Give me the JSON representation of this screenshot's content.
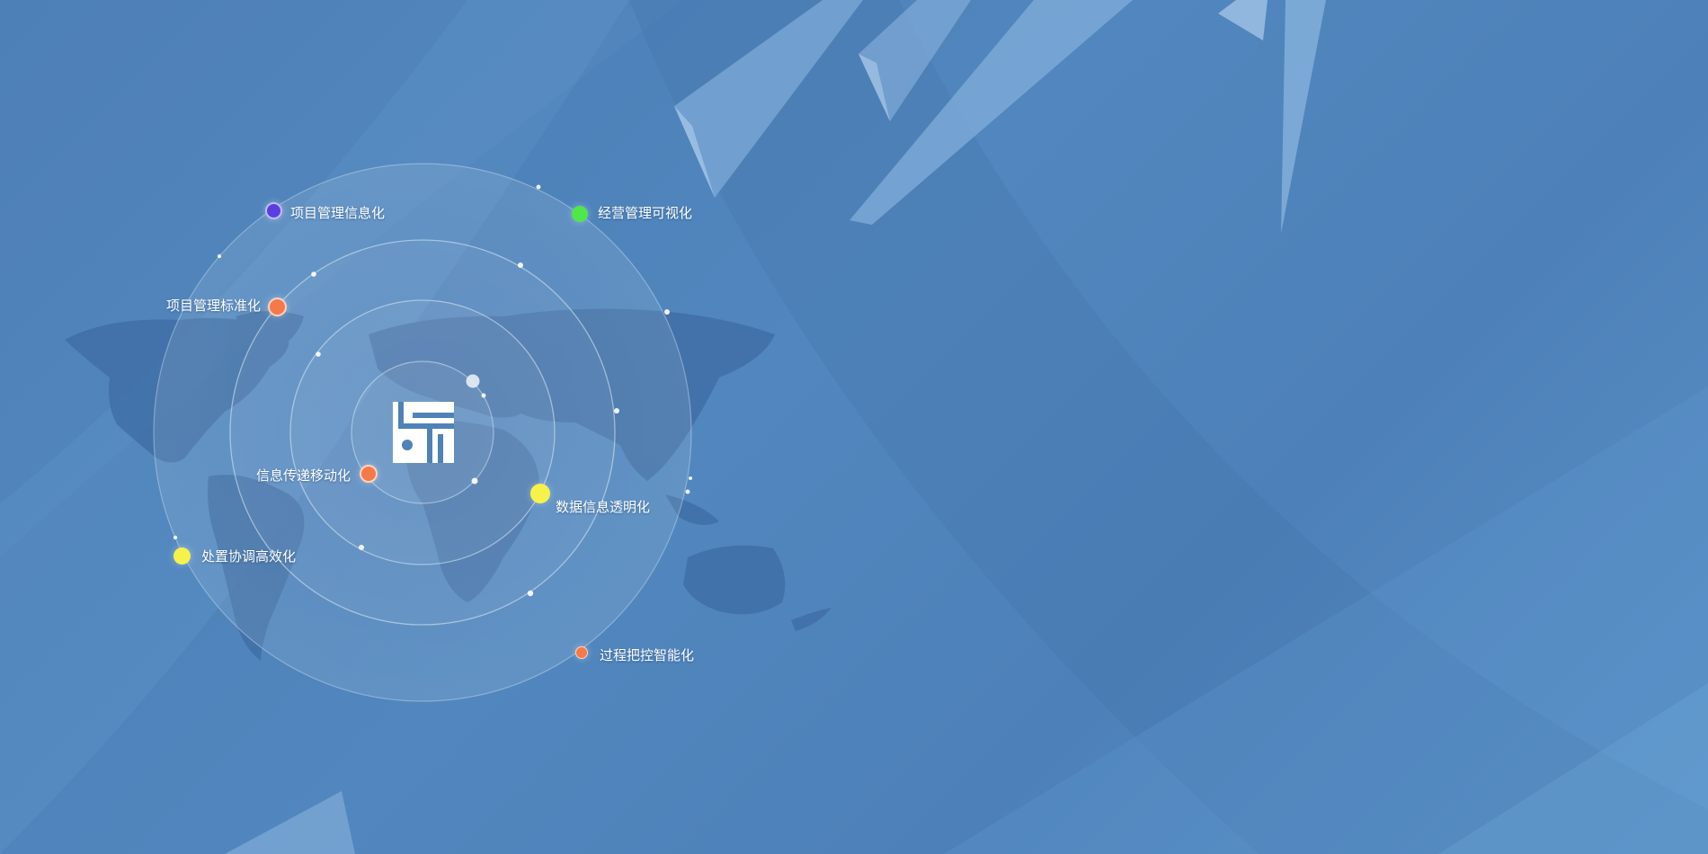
{
  "diagram": {
    "center_logo": "company-logo",
    "nodes": [
      {
        "label": "项目管理信息化",
        "color": "#5a3fe0"
      },
      {
        "label": "经营管理可视化",
        "color": "#4ee84a"
      },
      {
        "label": "项目管理标准化",
        "color": "#f47a4a"
      },
      {
        "label": "信息传递移动化",
        "color": "#f47a4a"
      },
      {
        "label": "数据信息透明化",
        "color": "#f6f24a"
      },
      {
        "label": "处置协调高效化",
        "color": "#f6f24a"
      },
      {
        "label": "过程把控智能化",
        "color": "#f47a4a"
      }
    ]
  },
  "colors": {
    "background": "#4f82b8",
    "map": "#3f6fa6",
    "ring": "#c9dcef"
  }
}
